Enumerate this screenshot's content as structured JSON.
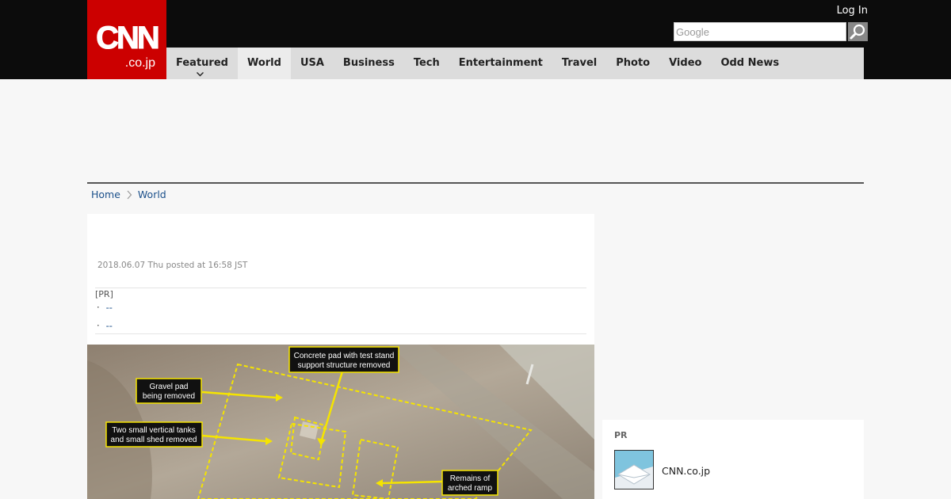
{
  "header": {
    "logo_main": "CNN",
    "logo_sub": ".co.jp",
    "login_label": "Log In",
    "search_placeholder": "Google"
  },
  "nav": {
    "items": [
      {
        "label": "Featured"
      },
      {
        "label": "World"
      },
      {
        "label": "USA"
      },
      {
        "label": "Business"
      },
      {
        "label": "Tech"
      },
      {
        "label": "Entertainment"
      },
      {
        "label": "Travel"
      },
      {
        "label": "Photo"
      },
      {
        "label": "Video"
      },
      {
        "label": "Odd News"
      }
    ],
    "active": "World"
  },
  "breadcrumb": {
    "home": "Home",
    "current": "World"
  },
  "article": {
    "posted": "2018.06.07 Thu posted at 16:58 JST",
    "pr_label": "[PR]",
    "pr_links": [
      "--",
      "--"
    ],
    "photo_labels": {
      "concrete_pad_1": "Concrete pad with test stand",
      "concrete_pad_2": "support structure removed",
      "gravel_pad_1": "Gravel pad",
      "gravel_pad_2": "being removed",
      "tanks_1": "Two small vertical tanks",
      "tanks_2": "and small shed removed",
      "ramp_1": "Remains of",
      "ramp_2": "arched ramp"
    }
  },
  "sidebar": {
    "pr_label": "PR",
    "item_name": "CNN.co.jp"
  },
  "colors": {
    "brand_red": "#cc0000",
    "topbar": "#0c0c0c",
    "nav_bg": "#dcdcdc",
    "link": "#1a4f8a",
    "annotation_yellow": "#f5e400"
  }
}
